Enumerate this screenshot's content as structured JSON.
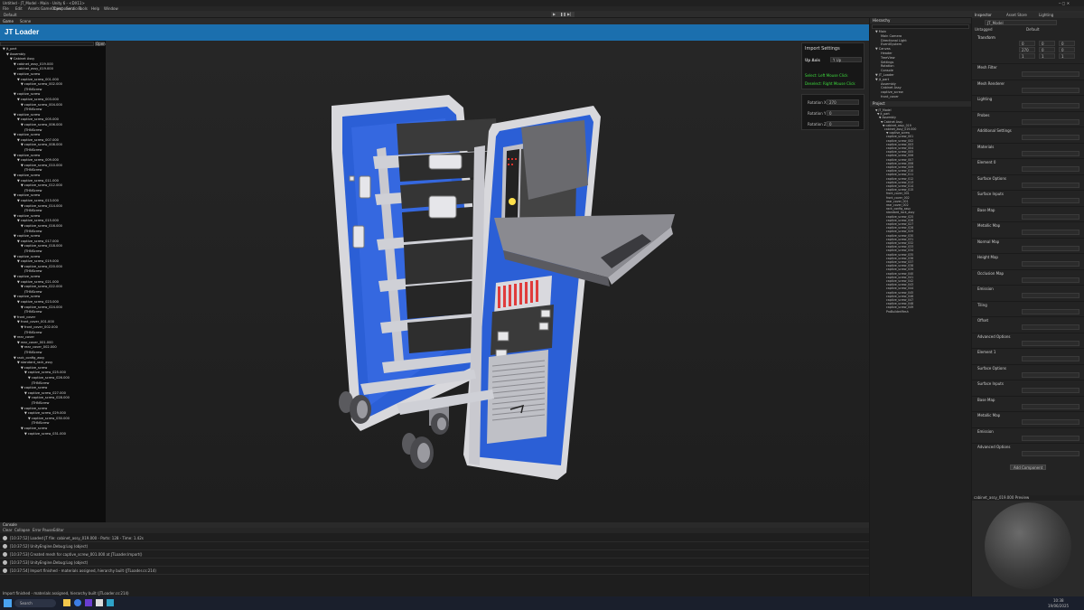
{
  "titlebar": {
    "title": "Untitled - JT_Model - Main - Unity 6 - <DX11>"
  },
  "menu": [
    "File",
    "Edit",
    "Assets",
    "GameObject",
    "Component",
    "Services",
    "Tools",
    "Help",
    "Window"
  ],
  "toolbar": {
    "account": "Default",
    "play": "▶",
    "pause": "❚❚",
    "step": "▶|",
    "layers": "Layers",
    "layout": "Layout"
  },
  "game_tabs": [
    "Game",
    "Scene"
  ],
  "header": {
    "title": "JT Loader",
    "open_label": "Open"
  },
  "tree": {
    "items": [
      {
        "label": "▼ jt_part",
        "indent": 0
      },
      {
        "label": "▼ Assembly",
        "indent": 1
      },
      {
        "label": "▼ Cabinet Assy",
        "indent": 2
      },
      {
        "label": "▼ cabinet_assy_019.000",
        "indent": 3
      },
      {
        "label": "cabinet_assy_019.000",
        "indent": 4
      },
      {
        "label": "▼ captive_screw",
        "indent": 3
      },
      {
        "label": "▼ captive_screw_001.000",
        "indent": 4
      },
      {
        "label": "▼ captive_screw_002.000",
        "indent": 5
      },
      {
        "label": "JTHNScrew",
        "indent": 6
      },
      {
        "label": "▼ captive_screw",
        "indent": 3
      },
      {
        "label": "▼ captive_screw_003.000",
        "indent": 4
      },
      {
        "label": "▼ captive_screw_004.000",
        "indent": 5
      },
      {
        "label": "JTHNScrew",
        "indent": 6
      },
      {
        "label": "▼ captive_screw",
        "indent": 3
      },
      {
        "label": "▼ captive_screw_005.000",
        "indent": 4
      },
      {
        "label": "▼ captive_screw_006.000",
        "indent": 5
      },
      {
        "label": "JTHNScrew",
        "indent": 6
      },
      {
        "label": "▼ captive_screw",
        "indent": 3
      },
      {
        "label": "▼ captive_screw_007.000",
        "indent": 4
      },
      {
        "label": "▼ captive_screw_008.000",
        "indent": 5
      },
      {
        "label": "JTHNScrew",
        "indent": 6
      },
      {
        "label": "▼ captive_screw",
        "indent": 3
      },
      {
        "label": "▼ captive_screw_009.000",
        "indent": 4
      },
      {
        "label": "▼ captive_screw_010.000",
        "indent": 5
      },
      {
        "label": "JTHNScrew",
        "indent": 6
      },
      {
        "label": "▼ captive_screw",
        "indent": 3
      },
      {
        "label": "▼ captive_screw_011.000",
        "indent": 4
      },
      {
        "label": "▼ captive_screw_012.000",
        "indent": 5
      },
      {
        "label": "JTHNScrew",
        "indent": 6
      },
      {
        "label": "▼ captive_screw",
        "indent": 3
      },
      {
        "label": "▼ captive_screw_013.000",
        "indent": 4
      },
      {
        "label": "▼ captive_screw_014.000",
        "indent": 5
      },
      {
        "label": "JTHNScrew",
        "indent": 6
      },
      {
        "label": "▼ captive_screw",
        "indent": 3
      },
      {
        "label": "▼ captive_screw_015.000",
        "indent": 4
      },
      {
        "label": "▼ captive_screw_016.000",
        "indent": 5
      },
      {
        "label": "JTHNScrew",
        "indent": 6
      },
      {
        "label": "▼ captive_screw",
        "indent": 3
      },
      {
        "label": "▼ captive_screw_017.000",
        "indent": 4
      },
      {
        "label": "▼ captive_screw_018.000",
        "indent": 5
      },
      {
        "label": "JTHNScrew",
        "indent": 6
      },
      {
        "label": "▼ captive_screw",
        "indent": 3
      },
      {
        "label": "▼ captive_screw_019.000",
        "indent": 4
      },
      {
        "label": "▼ captive_screw_020.000",
        "indent": 5
      },
      {
        "label": "JTHNScrew",
        "indent": 6
      },
      {
        "label": "▼ captive_screw",
        "indent": 3
      },
      {
        "label": "▼ captive_screw_021.000",
        "indent": 4
      },
      {
        "label": "▼ captive_screw_022.000",
        "indent": 5
      },
      {
        "label": "JTHNScrew",
        "indent": 6
      },
      {
        "label": "▼ captive_screw",
        "indent": 3
      },
      {
        "label": "▼ captive_screw_023.000",
        "indent": 4
      },
      {
        "label": "▼ captive_screw_024.000",
        "indent": 5
      },
      {
        "label": "JTHNScrew",
        "indent": 6
      },
      {
        "label": "▼ front_cover",
        "indent": 3
      },
      {
        "label": "▼ front_cover_001.000",
        "indent": 4
      },
      {
        "label": "▼ front_cover_002.000",
        "indent": 5
      },
      {
        "label": "JTHNScrew",
        "indent": 6
      },
      {
        "label": "▼ rear_cover",
        "indent": 3
      },
      {
        "label": "▼ rear_cover_001.000",
        "indent": 4
      },
      {
        "label": "▼ rear_cover_002.000",
        "indent": 5
      },
      {
        "label": "JTHNScrew",
        "indent": 6
      },
      {
        "label": "▼ rack_config_assy",
        "indent": 3
      },
      {
        "label": "▼ standard_rack_assy",
        "indent": 4
      },
      {
        "label": "▼ captive_screw",
        "indent": 5
      },
      {
        "label": "▼ captive_screw_025.000",
        "indent": 6
      },
      {
        "label": "▼ captive_screw_026.000",
        "indent": 7
      },
      {
        "label": "JTHNScrew",
        "indent": 8
      },
      {
        "label": "▼ captive_screw",
        "indent": 5
      },
      {
        "label": "▼ captive_screw_027.000",
        "indent": 6
      },
      {
        "label": "▼ captive_screw_028.000",
        "indent": 7
      },
      {
        "label": "JTHNScrew",
        "indent": 8
      },
      {
        "label": "▼ captive_screw",
        "indent": 5
      },
      {
        "label": "▼ captive_screw_029.000",
        "indent": 6
      },
      {
        "label": "▼ captive_screw_030.000",
        "indent": 7
      },
      {
        "label": "JTHNScrew",
        "indent": 8
      },
      {
        "label": "▼ captive_screw",
        "indent": 5
      },
      {
        "label": "▼ captive_screw_031.000",
        "indent": 6
      }
    ]
  },
  "import_panel": {
    "title": "Import Settings",
    "upaxis_label": "Up Axis",
    "upaxis_value": "Y Up",
    "hint1": "Select: Left Mouse Click",
    "hint2": "Deselect: Right Mouse Click"
  },
  "rotation_panel": {
    "rows": [
      {
        "label": "Rotation X",
        "value": "270"
      },
      {
        "label": "Rotation Y",
        "value": "0"
      },
      {
        "label": "Rotation Z",
        "value": "0"
      }
    ]
  },
  "console": {
    "tab": "Console",
    "toolbar": [
      "Clear",
      "Collapse",
      "Error Pause",
      "Editor"
    ],
    "messages": [
      "[10:37:52] Loaded JT file: cabinet_assy_019.000 - Parts: 128 - Time: 1.42s",
      "[10:37:52] UnityEngine.Debug:Log (object)",
      "[10:37:53] Created mesh for captive_screw_001.000 at JTLoader.Import()",
      "[10:37:53] UnityEngine.Debug:Log (object)",
      "[10:37:54] Import finished - materials assigned, hierarchy built (JTLoader.cs:214)"
    ],
    "status": "Import finished - materials assigned, hierarchy built (JTLoader.cs:214)"
  },
  "hierarchy": {
    "tab": "Hierarchy",
    "items": [
      "▼ Main",
      "Main Camera",
      "Directional Light",
      "EventSystem",
      "▼ Canvas",
      "Header",
      "TreeView",
      "Settings",
      "Rotation",
      "Console",
      "▼ JT_Loader",
      "▼ jt_part",
      "Assembly",
      "Cabinet Assy",
      "captive_screw",
      "front_cover"
    ]
  },
  "project": {
    "tab": "Project",
    "items": [
      "▼ JT_Model",
      "▼ jt_part",
      "▼ Assembly",
      "▼ Cabinet Assy",
      "▼ cabinet_assy_019",
      "cabinet_assy_019.000",
      "▼ captive_screw",
      "captive_screw_001",
      "captive_screw_002",
      "captive_screw_003",
      "captive_screw_004",
      "captive_screw_005",
      "captive_screw_006",
      "captive_screw_007",
      "captive_screw_008",
      "captive_screw_009",
      "captive_screw_010",
      "captive_screw_011",
      "captive_screw_012",
      "captive_screw_013",
      "captive_screw_014",
      "captive_screw_015",
      "front_cover_001",
      "front_cover_002",
      "rear_cover_001",
      "rear_cover_002",
      "rack_config_assy",
      "standard_rack_assy",
      "captive_screw_025",
      "captive_screw_026",
      "captive_screw_027",
      "captive_screw_028",
      "captive_screw_029",
      "captive_screw_030",
      "captive_screw_031",
      "captive_screw_032",
      "captive_screw_033",
      "captive_screw_034",
      "captive_screw_035",
      "captive_screw_036",
      "captive_screw_037",
      "captive_screw_038",
      "captive_screw_039",
      "captive_screw_040",
      "captive_screw_041",
      "captive_screw_042",
      "captive_screw_043",
      "captive_screw_044",
      "captive_screw_045",
      "captive_screw_046",
      "captive_screw_047",
      "captive_screw_048",
      "captive_screw_049",
      "ProBuilderMesh"
    ]
  },
  "inspector": {
    "tabs": [
      "Inspector",
      "Asset Store",
      "Lighting"
    ],
    "object_name": "JT_Model",
    "tag": "Untagged",
    "layer": "Default",
    "transform": "Transform",
    "position": [
      "0",
      "0",
      "0"
    ],
    "rotation": [
      "270",
      "0",
      "0"
    ],
    "scale": [
      "1",
      "1",
      "1"
    ],
    "sections": [
      "Mesh Filter",
      "Mesh Renderer",
      "Lighting",
      "Probes",
      "Additional Settings",
      "Materials",
      "Element 0",
      "Surface Options",
      "Surface Inputs",
      "Base Map",
      "Metallic Map",
      "Normal Map",
      "Height Map",
      "Occlusion Map",
      "Emission",
      "Tiling",
      "Offset",
      "Advanced Options",
      "Element 1",
      "Surface Options",
      "Surface Inputs",
      "Base Map",
      "Metallic Map",
      "Emission",
      "Advanced Options"
    ],
    "add_component": "Add Component"
  },
  "preview": {
    "title": "cabinet_assy_019.000 Preview"
  },
  "taskbar": {
    "search": "Search",
    "time": "10:38",
    "date": "19/06/2025"
  },
  "colors": {
    "accent": "#1b6fae",
    "cabinet_blue": "#2b5fd6",
    "cabinet_white": "#d8d8dc",
    "green_hint": "#3ddc3d",
    "console_bg": "#1e1e1e"
  }
}
